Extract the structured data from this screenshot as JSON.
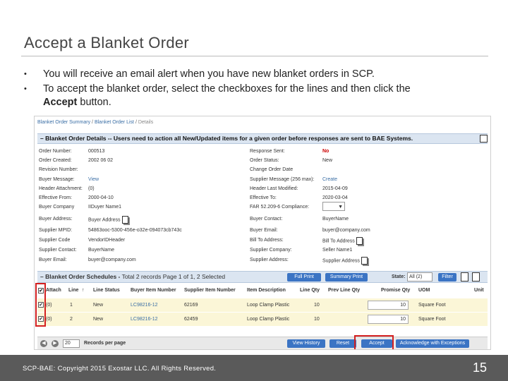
{
  "slide": {
    "title": "Accept a Blanket Order",
    "bullets": [
      "You will receive an email alert when you have new blanket orders in SCP.",
      "To accept the blanket order, select the checkboxes for the lines and then click the"
    ],
    "bullet2_bold": "Accept",
    "bullet2_tail": " button.",
    "bullet_marker": "•",
    "footer_copyright": "SCP-BAE:  Copyright 2015 Exostar LLC. All Rights Reserved.",
    "page_number": "15"
  },
  "app": {
    "breadcrumb": [
      "Blanket Order Summary",
      "Blanket Order List",
      "Details"
    ],
    "breadcrumb_sep": "/",
    "details_header": "– Blanket Order Details -- Users need to action all New/Updated items for a given order before responses are sent to BAE Systems.",
    "left_fields": [
      {
        "label": "Order Number:",
        "value": "000513"
      },
      {
        "label": "Order Created:",
        "value": "2002 06 02"
      },
      {
        "label": "Revision Number:",
        "value": ""
      },
      {
        "label": "Buyer Message:",
        "value": "View",
        "link": true
      },
      {
        "label": "Header Attachment:",
        "value": "(0)"
      },
      {
        "label": "Effective From:",
        "value": "2000-04-10"
      },
      {
        "label": "Buyer Company",
        "value": "IIDuyer Name1"
      },
      {
        "label": "Buyer Address:",
        "value": "Buyer Address"
      },
      {
        "label": "Supplier MPID:",
        "value": "54863ooc-5300-456e-o32e-094073cb743c"
      },
      {
        "label": "Supplier Code",
        "value": "VendorIDHeader"
      },
      {
        "label": "Supplier Contact:",
        "value": "BuyerName"
      },
      {
        "label": "Buyer Email:",
        "value": "buyer@company.com"
      }
    ],
    "right_fields": [
      {
        "label": "Response Sent:",
        "value": "No",
        "red": true
      },
      {
        "label": "Order Status:",
        "value": "New"
      },
      {
        "label": "Change Order Date",
        "value": ""
      },
      {
        "label": "Supplier Message (256 max):",
        "value": "Create",
        "link": true
      },
      {
        "label": "Header Last Modified:",
        "value": "2015-04-09"
      },
      {
        "label": "Effective To:",
        "value": "2020-03-04"
      },
      {
        "label": "FAR 52.209-6 Compliance:",
        "value": ""
      },
      {
        "label": "Buyer Contact:",
        "value": "BuyerName"
      },
      {
        "label": "Buyer Email:",
        "value": "buyer@company.com"
      },
      {
        "label": "Bill To Address:",
        "value": "Bill To Address"
      },
      {
        "label": "Supplier Company:",
        "value": "Seller Name1"
      },
      {
        "label": "Supplier Address:",
        "value": "Supplier Address"
      }
    ],
    "schedules": {
      "title": "– Blanket Order Schedules -",
      "summary": " Total 2 records Page 1 of 1, 2 Selected",
      "full_print": "Full Print",
      "summary_print": "Summary Print",
      "state_label": "State:",
      "state_value": "All (2)",
      "filter": "Filter",
      "columns": [
        "Attach",
        "Line",
        "Line Status",
        "Buyer Item Number",
        "Supplier Item Number",
        "Item Description",
        "Line Qty",
        "Prev Line Qty",
        "Promise Qty",
        "UOM",
        "Unit"
      ],
      "rows": [
        {
          "attach": "(0)",
          "line": "1",
          "status": "New",
          "buyer_item": "LC98216-12",
          "supplier_item": "62169",
          "desc": "Loop Clamp Plastic",
          "qty": "10",
          "prev_qty": "",
          "promise": "10",
          "uom": "Square Foot",
          "checked": true
        },
        {
          "attach": "(0)",
          "line": "2",
          "status": "New",
          "buyer_item": "LC98216-12",
          "supplier_item": "62459",
          "desc": "Loop Clamp Plastic",
          "qty": "10",
          "prev_qty": "",
          "promise": "10",
          "uom": "Square Foot",
          "checked": true
        }
      ],
      "check_mark": "✔",
      "sort_arrow": "↑",
      "per_page": "20",
      "per_page_label": "Records per page",
      "buttons": {
        "view_history": "View History",
        "reset": "Reset",
        "accept": "Accept",
        "ack_exceptions": "Acknowledge with Exceptions"
      }
    }
  },
  "colors": {
    "highlight_red": "#d32020",
    "row_yellow": "#fbf6d7",
    "header_blue": "#dbe5f1",
    "button_blue": "#3b74c4",
    "footer_gray": "#5a5a5a"
  }
}
